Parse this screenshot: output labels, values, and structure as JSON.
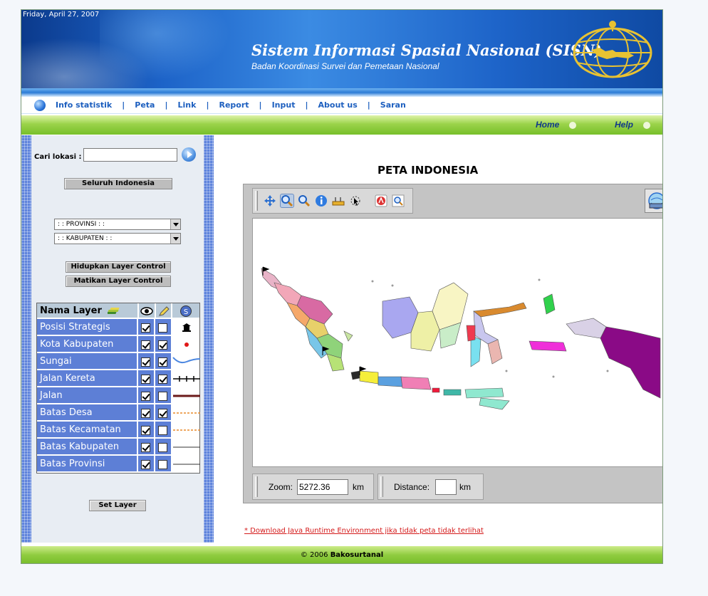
{
  "header": {
    "date": "Friday, April 27, 2007",
    "title": "Sistem Informasi Spasial Nasional (SISN)",
    "subtitle": "Badan Koordinasi Survei dan Pemetaan Nasional"
  },
  "nav": {
    "items": [
      {
        "label": "Info statistik"
      },
      {
        "label": "Peta"
      },
      {
        "label": "Link"
      },
      {
        "label": "Report"
      },
      {
        "label": "Input"
      },
      {
        "label": "About us"
      },
      {
        "label": "Saran"
      }
    ]
  },
  "greenbar": {
    "home": "Home",
    "help": "Help"
  },
  "sidebar": {
    "search_label": "Cari lokasi :",
    "search_value": "",
    "whole_country": "Seluruh Indonesia",
    "province_select": ": : PROVINSI : :",
    "kabupaten_select": ": : KABUPATEN : :",
    "layer_on": "Hidupkan Layer Control",
    "layer_off": "Matikan Layer Control",
    "layer_header": "Nama Layer",
    "layers": [
      {
        "name": "Posisi Strategis",
        "visible": true,
        "active": false,
        "legend": "monument-icon"
      },
      {
        "name": "Kota Kabupaten",
        "visible": true,
        "active": true,
        "legend": "red-dot"
      },
      {
        "name": "Sungai",
        "visible": true,
        "active": true,
        "legend": "river-line"
      },
      {
        "name": "Jalan Kereta",
        "visible": true,
        "active": true,
        "legend": "railway-line"
      },
      {
        "name": "Jalan",
        "visible": true,
        "active": false,
        "legend": "road-line"
      },
      {
        "name": "Batas Desa",
        "visible": true,
        "active": true,
        "legend": "dashed-orange"
      },
      {
        "name": "Batas Kecamatan",
        "visible": true,
        "active": false,
        "legend": "dashed-orange"
      },
      {
        "name": "Batas Kabupaten",
        "visible": true,
        "active": false,
        "legend": "thin-line"
      },
      {
        "name": "Batas Provinsi",
        "visible": true,
        "active": false,
        "legend": "thin-line"
      }
    ],
    "set_layer": "Set Layer"
  },
  "main": {
    "title": "PETA INDONESIA",
    "zoom_label": "Zoom:",
    "zoom_value": "5272.36",
    "zoom_unit": "km",
    "distance_label": "Distance:",
    "distance_value": "",
    "distance_unit": "km",
    "download_note": "* Download Java Runtime Environment jika tidak peta tidak terlihat"
  },
  "footer": {
    "copyright": "© 2006",
    "org": "Bakosurtanal"
  },
  "colors": {
    "nav_blue": "#1d5fbf",
    "layer_blue": "#5d7fd6",
    "green": "#8fcc3f",
    "link_red": "#d41a1a"
  }
}
